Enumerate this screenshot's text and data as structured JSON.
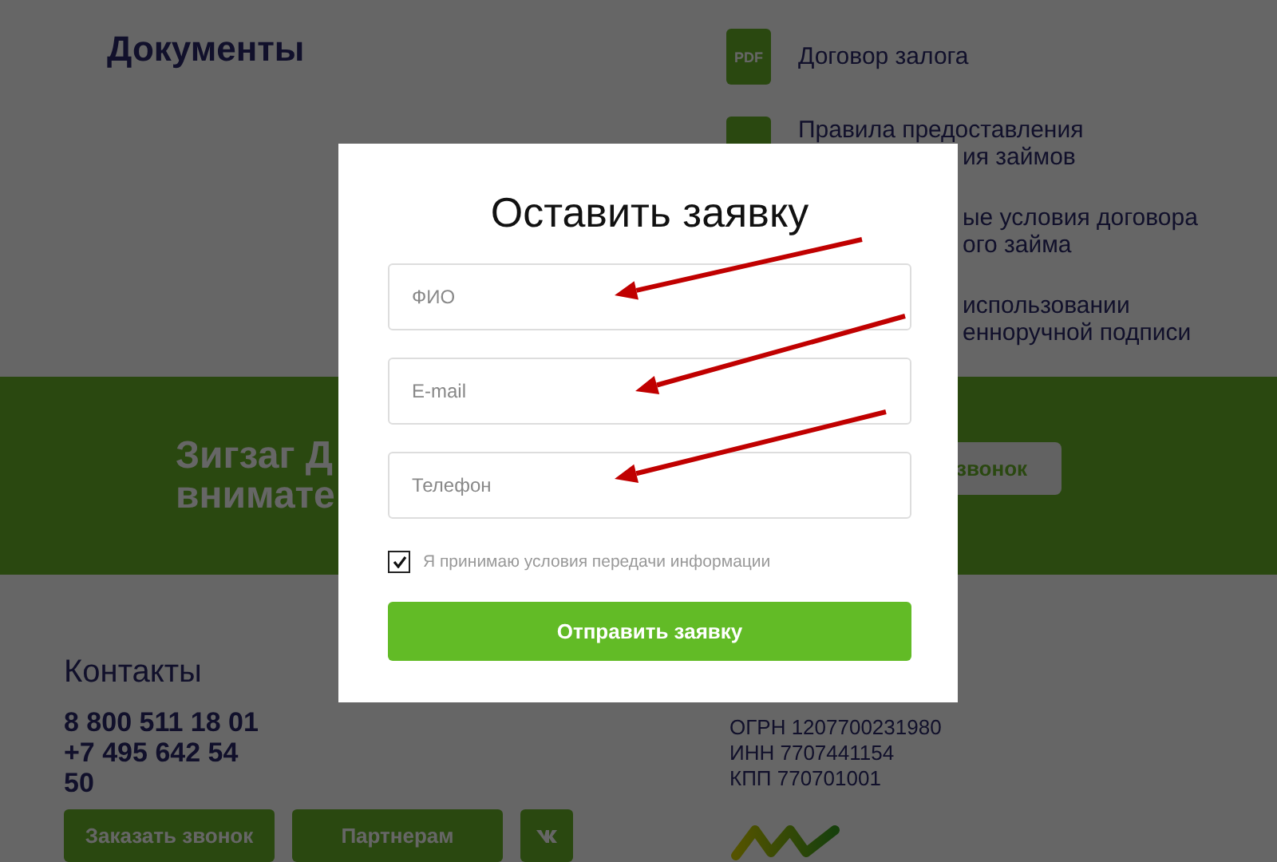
{
  "documents": {
    "title": "Документы",
    "items": [
      {
        "badge": "PDF",
        "lines": [
          "Договор залога"
        ]
      },
      {
        "lines": [
          "Правила предоставления",
          "ия займов"
        ]
      },
      {
        "lines": [
          "ые условия договора",
          "ого займа"
        ]
      },
      {
        "lines": [
          "использовании",
          "енноручной подписи"
        ]
      }
    ]
  },
  "banner": {
    "lines": [
      "Зигзаг Д",
      "внимате"
    ],
    "button": "звонок"
  },
  "contacts": {
    "title": "Контакты",
    "phones": [
      "8 800 511 18 01",
      "+7 495 642 54 50"
    ],
    "buttons": [
      "Заказать звонок",
      "Партнерам"
    ]
  },
  "company": {
    "lines": [
      "ОГРН 1207700231980",
      "ИНН 7707441154",
      "КПП 770701001"
    ]
  },
  "modal": {
    "title": "Оставить заявку",
    "fields": [
      {
        "placeholder": "ФИО"
      },
      {
        "placeholder": "E-mail"
      },
      {
        "placeholder": "Телефон"
      }
    ],
    "consent": {
      "label": "Я принимаю условия передачи информации",
      "checked": true
    },
    "submit": "Отправить заявку"
  },
  "annotations": [
    {
      "kind": "arrow"
    },
    {
      "kind": "arrow"
    },
    {
      "kind": "arrow"
    }
  ]
}
